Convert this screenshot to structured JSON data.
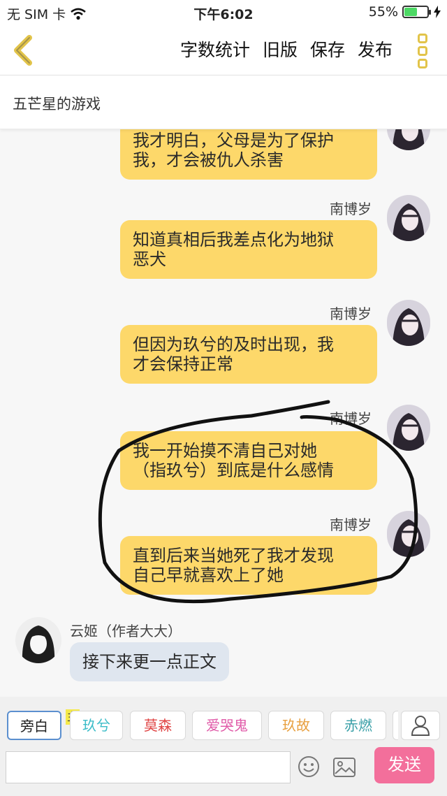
{
  "status_bar": {
    "carrier": "无 SIM 卡",
    "time": "下午6:02",
    "battery_percent": "55%",
    "battery_level": 0.55,
    "icons": [
      "wifi-icon",
      "battery-icon",
      "charging-icon"
    ]
  },
  "nav": {
    "back_icon": "chevron-left-icon",
    "actions": [
      "字数统计",
      "旧版",
      "保存",
      "发布"
    ],
    "more_icon": "more-vertical-icon"
  },
  "title": "五芒星的游戏",
  "messages": [
    {
      "side": "right",
      "speaker": "",
      "text_lines": [
        "我才明白，父母是为了保护",
        "我，才会被仇人杀害"
      ]
    },
    {
      "side": "right",
      "speaker": "南博岁",
      "text_lines": [
        "知道真相后我差点化为地狱",
        "恶犬"
      ]
    },
    {
      "side": "right",
      "speaker": "南博岁",
      "text_lines": [
        "但因为玖兮的及时出现，我",
        "才会保持正常"
      ]
    },
    {
      "side": "right",
      "speaker": "南博岁",
      "text_lines": [
        "我一开始摸不清自己对她",
        "（指玖兮）到底是什么感情"
      ]
    },
    {
      "side": "right",
      "speaker": "南博岁",
      "text_lines": [
        "直到后来当她死了我才发现",
        "自己早就喜欢上了她"
      ]
    },
    {
      "side": "left",
      "speaker": "云姬（作者大大）",
      "text_lines": [
        "接下来更一点正文"
      ]
    }
  ],
  "roles": {
    "badge": "主",
    "items": [
      {
        "label": "旁白",
        "color": "#222222",
        "active": true
      },
      {
        "label": "玖兮",
        "color": "#3bbcc8"
      },
      {
        "label": "莫森",
        "color": "#e04545"
      },
      {
        "label": "爱哭鬼",
        "color": "#e05aa8"
      },
      {
        "label": "玖故",
        "color": "#e8a040"
      },
      {
        "label": "赤燃",
        "color": "#3ba0a8"
      }
    ],
    "profile_icon": "user-icon"
  },
  "composer": {
    "input_value": "",
    "emoji_icon": "emoji-icon",
    "image_icon": "image-icon",
    "send_label": "发送"
  },
  "colors": {
    "bubble_right": "#fdd86a",
    "bubble_left": "#dfe6ef",
    "send_button": "#f36f9b",
    "accent": "#e2c44a"
  }
}
